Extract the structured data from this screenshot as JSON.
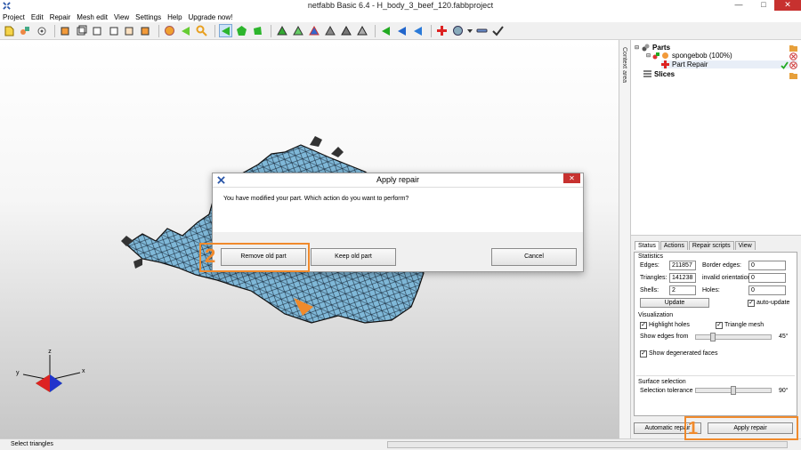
{
  "window": {
    "title": "netfabb Basic 6.4 - H_body_3_beef_120.fabbproject",
    "min_glyph": "—",
    "max_glyph": "□",
    "close_glyph": "✕"
  },
  "menu": [
    "Project",
    "Edit",
    "Repair",
    "Mesh edit",
    "View",
    "Settings",
    "Help",
    "Upgrade now!"
  ],
  "context_area_label": "Context area",
  "tree": {
    "parts_label": "Parts",
    "part_label": "spongebob (100%)",
    "repair_label": "Part Repair",
    "slices_label": "Slices"
  },
  "tabs": [
    "Status",
    "Actions",
    "Repair scripts",
    "View"
  ],
  "statistics": {
    "heading": "Statistics",
    "edges_label": "Edges:",
    "edges_value": "211857",
    "border_edges_label": "Border edges:",
    "border_edges_value": "0",
    "triangles_label": "Triangles:",
    "triangles_value": "141238",
    "invalid_orientation_label": "invalid orientation",
    "invalid_orientation_value": "0",
    "shells_label": "Shells:",
    "shells_value": "2",
    "holes_label": "Holes:",
    "holes_value": "0",
    "update_button": "Update",
    "auto_update_label": "auto-update"
  },
  "visualization": {
    "heading": "Visualization",
    "highlight_holes": "Highlight holes",
    "triangle_mesh": "Triangle mesh",
    "show_edges_from": "Show edges from",
    "show_edges_value": "45°",
    "show_edges_level_percent": 25,
    "show_degenerated": "Show degenerated faces"
  },
  "surface_selection": {
    "heading": "Surface selection",
    "tolerance_label": "Selection tolerance",
    "tolerance_value": "90°",
    "tolerance_level_percent": 50
  },
  "bottom_buttons": {
    "automatic_repair": "Automatic repair",
    "apply_repair": "Apply repair"
  },
  "status": {
    "text": "Select triangles"
  },
  "dialog": {
    "title": "Apply repair",
    "close_glyph": "✕",
    "message": "You have modified your part. Which action do you want to perform?",
    "remove_old": "Remove old part",
    "keep_old": "Keep old part",
    "cancel": "Cancel"
  },
  "annotations": {
    "step1": "1",
    "step2": "2"
  },
  "axes": {
    "x": "x",
    "y": "y",
    "z": "z"
  },
  "colors": {
    "highlight": "#f08a2c",
    "mesh": "#7fb8d8",
    "close_red": "#c7312f"
  }
}
